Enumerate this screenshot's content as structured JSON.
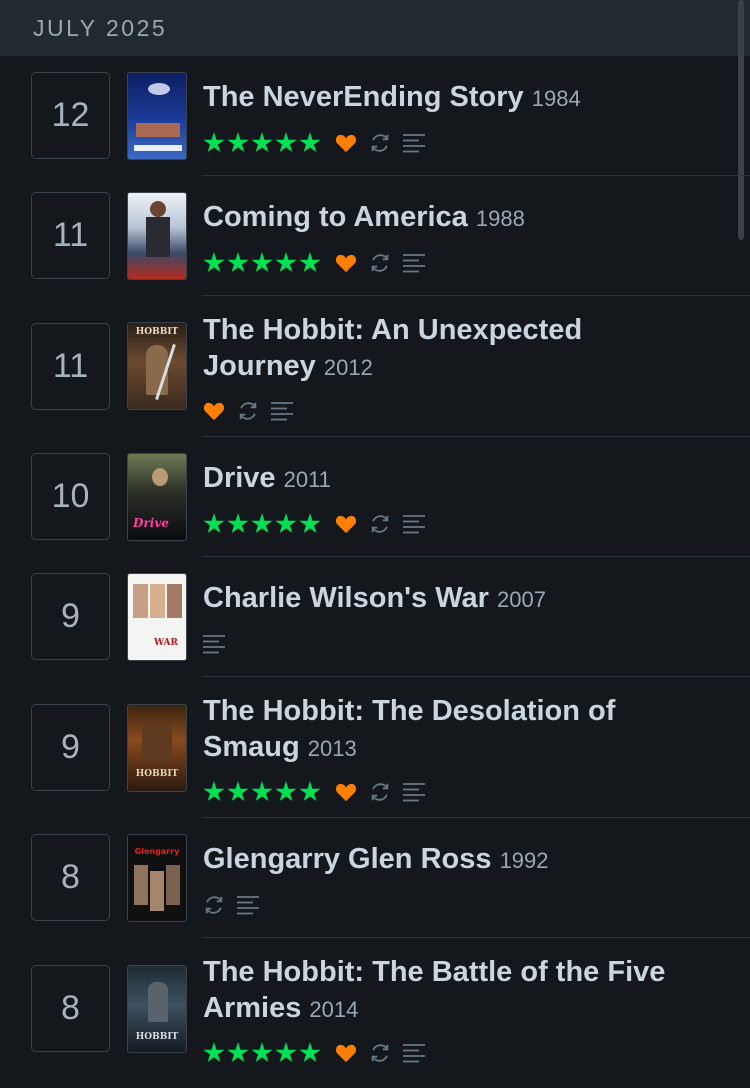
{
  "month_header": {
    "label": "JULY 2025"
  },
  "colors": {
    "star": "#00e054",
    "heart": "#ff8000",
    "icon_muted": "#687886"
  },
  "entries": [
    {
      "day": "12",
      "title": "The NeverEnding Story",
      "year": "1984",
      "stars": 5,
      "liked": true,
      "rewatch": true,
      "review": true
    },
    {
      "day": "11",
      "title": "Coming to America",
      "year": "1988",
      "stars": 5,
      "liked": true,
      "rewatch": true,
      "review": true
    },
    {
      "day": "11",
      "title_line1": "The Hobbit: An Unexpected",
      "title_line2": "Journey",
      "year": "2012",
      "stars": 0,
      "liked": true,
      "rewatch": true,
      "review": true,
      "poster_text": "HOBBIT"
    },
    {
      "day": "10",
      "title": "Drive",
      "year": "2011",
      "stars": 5,
      "liked": true,
      "rewatch": true,
      "review": true,
      "poster_text": "Drive"
    },
    {
      "day": "9",
      "title": "Charlie Wilson's War",
      "year": "2007",
      "stars": 0,
      "liked": false,
      "rewatch": false,
      "review": true,
      "poster_text": "WAR"
    },
    {
      "day": "9",
      "title_line1": "The Hobbit: The Desolation of",
      "title_line2": "Smaug",
      "year": "2013",
      "stars": 5,
      "liked": true,
      "rewatch": true,
      "review": true,
      "poster_text": "HOBBIT"
    },
    {
      "day": "8",
      "title": "Glengarry Glen Ross",
      "year": "1992",
      "stars": 0,
      "liked": false,
      "rewatch": true,
      "review": true,
      "poster_text": "Glengarry"
    },
    {
      "day": "8",
      "title_line1": "The Hobbit: The Battle of the Five",
      "title_line2": "Armies",
      "year": "2014",
      "stars": 5,
      "liked": true,
      "rewatch": true,
      "review": true,
      "poster_text": "HOBBIT"
    }
  ]
}
